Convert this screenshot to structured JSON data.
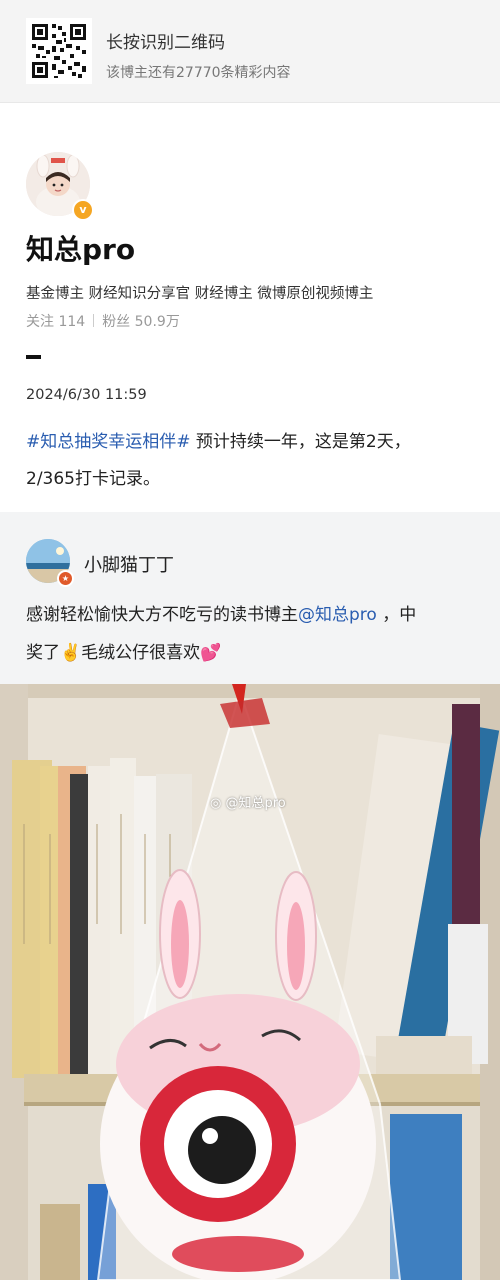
{
  "qr_banner": {
    "title": "长按识别二维码",
    "subtitle": "该博主还有27770条精彩内容"
  },
  "blogger": {
    "name": "知总pro",
    "tags": "基金博主 财经知识分享官 财经博主 微博原创视频博主",
    "follow_label": "关注",
    "follow_count": "114",
    "fans_label": "粉丝",
    "fans_count": "50.9万"
  },
  "post": {
    "time": "2024/6/30 11:59",
    "hashtag": "#知总抽奖幸运相伴#",
    "text_line1": " 预计持续一年，这是第2天，",
    "text_line2": "2/365打卡记录。"
  },
  "comment": {
    "user": "小脚猫丁丁",
    "text_before": "感谢轻松愉快大方不吃亏的读书博主",
    "mention": "@知总pro",
    "text_after1": " ，中",
    "text_line2": "奖了✌️毛绒公仔很喜欢💕"
  },
  "photo": {
    "watermark": "@知总pro"
  },
  "colors": {
    "link_blue": "#2a5db0",
    "verified_orange": "#f5a623",
    "banner_bg": "#f4f4f4",
    "comment_bg": "#f3f4f5"
  },
  "icons": [
    "qr-code-icon",
    "verified-badge-icon",
    "weibo-logo-icon"
  ]
}
